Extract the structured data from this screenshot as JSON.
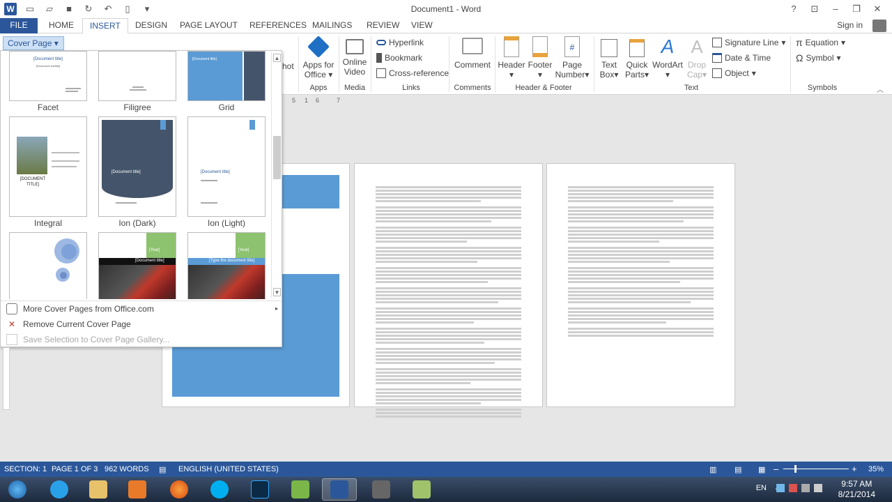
{
  "window": {
    "title": "Document1 - Word",
    "app_icon": "W",
    "controls": [
      "?",
      "restore-ribbon",
      "minimize",
      "maximize",
      "close"
    ]
  },
  "tabs": [
    {
      "label": "FILE"
    },
    {
      "label": "HOME"
    },
    {
      "label": "INSERT",
      "active": true
    },
    {
      "label": "DESIGN"
    },
    {
      "label": "PAGE LAYOUT"
    },
    {
      "label": "REFERENCES"
    },
    {
      "label": "MAILINGS"
    },
    {
      "label": "REVIEW"
    },
    {
      "label": "VIEW"
    }
  ],
  "signin": "Sign in",
  "ribbon": {
    "cover_page": "Cover Page",
    "partial_label": "hot",
    "apps": {
      "apps_for_office_line1": "Apps for",
      "apps_for_office_line2": "Office",
      "group": "Apps"
    },
    "media": {
      "online_video_line1": "Online",
      "online_video_line2": "Video",
      "group": "Media"
    },
    "links": {
      "hyperlink": "Hyperlink",
      "bookmark": "Bookmark",
      "cross_reference": "Cross-reference",
      "group": "Links"
    },
    "comments": {
      "comment": "Comment",
      "group": "Comments"
    },
    "header_footer": {
      "header": "Header",
      "footer": "Footer",
      "page_number_line1": "Page",
      "page_number_line2": "Number",
      "group": "Header & Footer"
    },
    "text": {
      "text_box_line1": "Text",
      "text_box_line2": "Box",
      "quick_parts_line1": "Quick",
      "quick_parts_line2": "Parts",
      "wordart": "WordArt",
      "drop_cap_line1": "Drop",
      "drop_cap_line2": "Cap",
      "signature_line": "Signature Line",
      "date_time": "Date & Time",
      "object": "Object",
      "group": "Text"
    },
    "symbols": {
      "equation": "Equation",
      "symbol": "Symbol",
      "group": "Symbols"
    }
  },
  "ruler": {
    "marks": [
      "5",
      "1",
      "6",
      "7"
    ]
  },
  "gallery": {
    "thumbnails": [
      {
        "label": "Facet",
        "doc_title": "[Document title]",
        "subtitle": "[Document subtitle]"
      },
      {
        "label": "Filigree"
      },
      {
        "label": "Grid",
        "doc_title": "[Document title]"
      },
      {
        "label": "Integral",
        "doc_title_line1": "[DOCUMENT",
        "doc_title_line2": "TITLE]"
      },
      {
        "label": "Ion (Dark)",
        "doc_title": "[Document title]"
      },
      {
        "label": "Ion (Light)",
        "doc_title": "[Document title]"
      },
      {
        "label": ""
      },
      {
        "label": "",
        "year": "[Year]",
        "doc_title": "[Document title]"
      },
      {
        "label": "",
        "year": "[Year]",
        "doc_title": "[Type the document title]"
      }
    ],
    "menu": {
      "more": "More Cover Pages from Office.com",
      "remove": "Remove Current Cover Page",
      "save": "Save Selection to Cover Page Gallery..."
    }
  },
  "statusbar": {
    "section": "SECTION: 1",
    "page": "PAGE 1 OF 3",
    "words": "962 WORDS",
    "language": "ENGLISH (UNITED STATES)",
    "zoom": "35%"
  },
  "taskbar": {
    "lang": "EN",
    "time": "9:57 AM",
    "date": "8/21/2014"
  },
  "colors": {
    "word_blue": "#2b579a",
    "accent_blue": "#5b9bd5",
    "ribbon_bg": "#ffffff"
  }
}
